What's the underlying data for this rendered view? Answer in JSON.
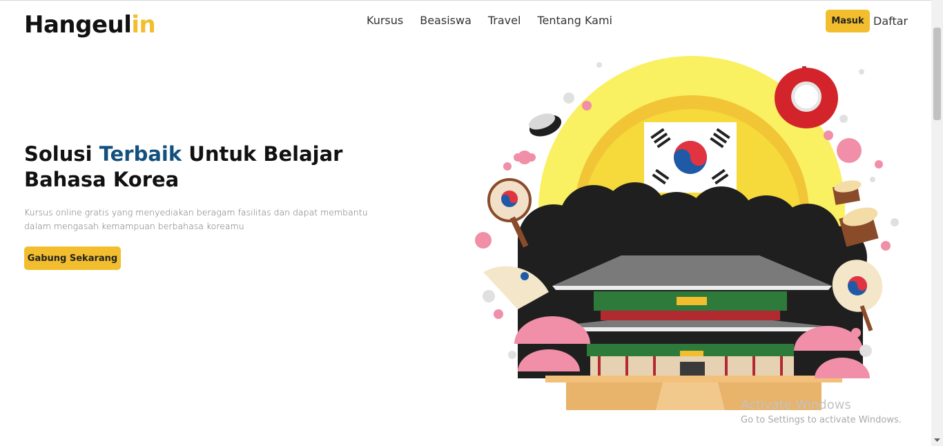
{
  "logo": {
    "main": "Hangeul",
    "accent": "in"
  },
  "nav": {
    "items": [
      {
        "label": "Kursus"
      },
      {
        "label": "Beasiswa"
      },
      {
        "label": "Travel"
      },
      {
        "label": "Tentang Kami"
      }
    ]
  },
  "auth": {
    "login": "Masuk",
    "register": "Daftar"
  },
  "hero": {
    "title_part1": "Solusi ",
    "title_highlight": "Terbaik",
    "title_part2": " Untuk Belajar Bahasa Korea",
    "description": "Kursus online gratis yang menyediakan beragam fasilitas dan dapat membantu dalam mengasah kemampuan berbahasa koreamu",
    "cta": "Gabung Sekarang"
  },
  "watermark": {
    "title": "Activate Windows",
    "subtitle": "Go to Settings to activate Windows."
  },
  "colors": {
    "accent": "#f2be2e",
    "highlight": "#14507e",
    "sun": "#f9e24c"
  }
}
